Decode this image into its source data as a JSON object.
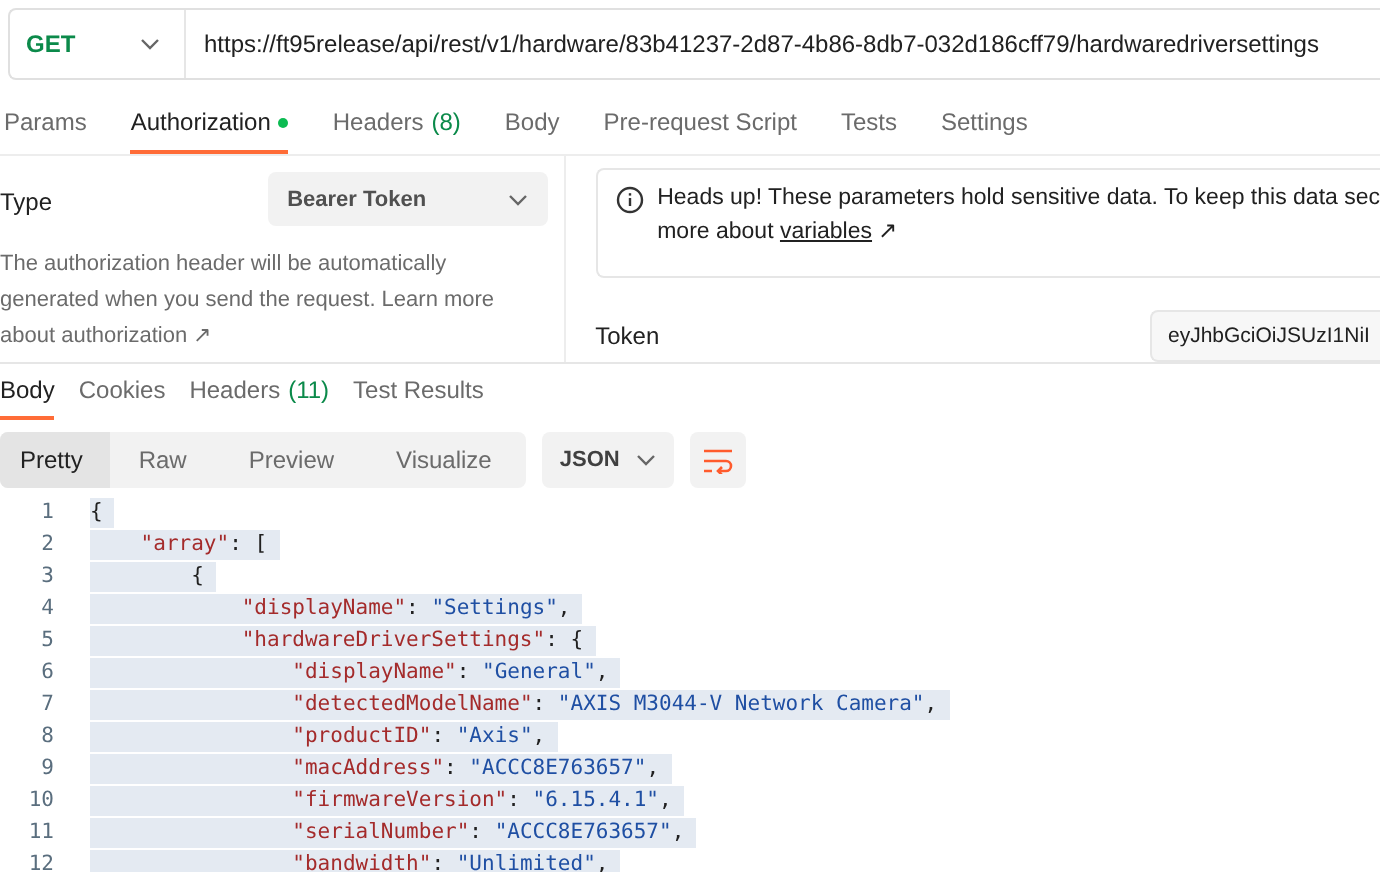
{
  "request": {
    "method": "GET",
    "url": "https://ft95release/api/rest/v1/hardware/83b41237-2d87-4b86-8db7-032d186cff79/hardwaredriversettings"
  },
  "request_tabs": [
    {
      "label": "Params",
      "selected": false
    },
    {
      "label": "Authorization",
      "selected": true,
      "status_dot": true
    },
    {
      "label": "Headers",
      "count": "(8)",
      "selected": false
    },
    {
      "label": "Body",
      "selected": false
    },
    {
      "label": "Pre-request Script",
      "selected": false
    },
    {
      "label": "Tests",
      "selected": false
    },
    {
      "label": "Settings",
      "selected": false
    }
  ],
  "authorization": {
    "type_label": "Type",
    "type_value": "Bearer Token",
    "description": "The authorization header will be automatically generated when you send the request. Learn more about",
    "description_link": "authorization ↗",
    "notice": {
      "text": "Heads up! These parameters hold sensitive data. To keep this data sec",
      "text_2": "more about",
      "link": "variables",
      "link_arrow": "↗"
    },
    "token_label": "Token",
    "token_value": "eyJhbGciOiJSUzI1NiI"
  },
  "response_tabs": [
    {
      "label": "Body",
      "selected": true
    },
    {
      "label": "Cookies",
      "selected": false
    },
    {
      "label": "Headers",
      "count": "(11)",
      "selected": false
    },
    {
      "label": "Test Results",
      "selected": false
    }
  ],
  "view_modes": [
    {
      "label": "Pretty",
      "selected": true
    },
    {
      "label": "Raw",
      "selected": false
    },
    {
      "label": "Preview",
      "selected": false
    },
    {
      "label": "Visualize",
      "selected": false
    }
  ],
  "format": "JSON",
  "code": {
    "selected": true,
    "lines": [
      {
        "number": "1",
        "text": "{"
      },
      {
        "number": "2",
        "text": "    \"array\": ["
      },
      {
        "number": "3",
        "text": "        {"
      },
      {
        "number": "4",
        "text": "            \"displayName\": \"Settings\","
      },
      {
        "number": "5",
        "text": "            \"hardwareDriverSettings\": {"
      },
      {
        "number": "6",
        "text": "                \"displayName\": \"General\","
      },
      {
        "number": "7",
        "text": "                \"detectedModelName\": \"AXIS M3044-V Network Camera\","
      },
      {
        "number": "8",
        "text": "                \"productID\": \"Axis\","
      },
      {
        "number": "9",
        "text": "                \"macAddress\": \"ACCC8E763657\","
      },
      {
        "number": "10",
        "text": "                \"firmwareVersion\": \"6.15.4.1\","
      },
      {
        "number": "11",
        "text": "                \"serialNumber\": \"ACCC8E763657\","
      },
      {
        "number": "12",
        "text": "                \"bandwidth\": \"Unlimited\","
      }
    ]
  }
}
